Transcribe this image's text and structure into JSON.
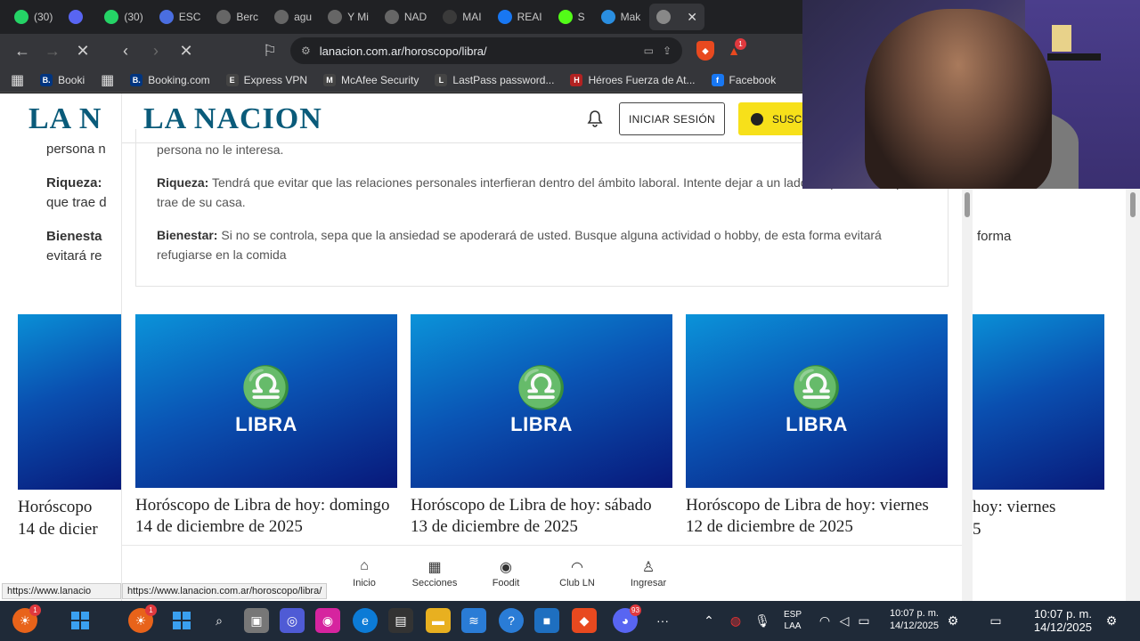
{
  "browser": {
    "tabs": [
      {
        "label": "(30)",
        "icon": "whatsapp-icon",
        "color": "#25d366"
      },
      {
        "label": "",
        "icon": "discord-icon",
        "color": "#5865f2"
      },
      {
        "label": "(30)",
        "icon": "whatsapp-icon",
        "color": "#25d366"
      },
      {
        "label": "ESC",
        "icon": "app-icon",
        "color": "#4a6ee0"
      },
      {
        "label": "Berc",
        "icon": "globe-icon",
        "color": "#666"
      },
      {
        "label": "agu",
        "icon": "globe-icon",
        "color": "#666"
      },
      {
        "label": "Y Mi",
        "icon": "globe-icon",
        "color": "#666"
      },
      {
        "label": "NAD",
        "icon": "globe-icon",
        "color": "#666"
      },
      {
        "label": "MAI",
        "icon": "app-icon",
        "color": "#3a3a3a"
      },
      {
        "label": "REAI",
        "icon": "facebook-icon",
        "color": "#1877f2"
      },
      {
        "label": "S",
        "icon": "kick-icon",
        "color": "#53fc18"
      },
      {
        "label": "Mak",
        "icon": "app-icon",
        "color": "#2a8ee0"
      },
      {
        "label": "",
        "icon": "loading-icon",
        "color": "#888"
      }
    ],
    "url": "lanacion.com.ar/horoscopo/libra/",
    "shield_badge": "1",
    "bookmarks": [
      {
        "label": "Booking.com",
        "color": "#003580",
        "glyph": "B."
      },
      {
        "label": "Express VPN",
        "color": "#444",
        "glyph": "E"
      },
      {
        "label": "McAfee Security",
        "color": "#444",
        "glyph": "M"
      },
      {
        "label": "LastPass password...",
        "color": "#444",
        "glyph": "L"
      },
      {
        "label": "Héroes Fuerza de At...",
        "color": "#b22222",
        "glyph": "H"
      },
      {
        "label": "Facebook",
        "color": "#1877f2",
        "glyph": "f"
      }
    ],
    "ghost_bookmark": "Booki"
  },
  "site": {
    "logo": "LA NACION",
    "ghost_logo": "LA N",
    "login_label": "INICIAR SESIÓN",
    "subscribe_label": "SUSCR"
  },
  "horoscope": {
    "love_tail": "persona no le interesa.",
    "wealth_label": "Riqueza:",
    "wealth_text": " Tendrá que evitar que las relaciones personales interfieran dentro del ámbito laboral. Intente dejar a un lado los problemas que trae de su casa.",
    "wellbeing_label": "Bienestar:",
    "wellbeing_text": " Si no se controla, sepa que la ansiedad se apoderará de usted. Busque alguna actividad o hobby, de esta forma evitará refugiarse en la comida"
  },
  "ghost_left": {
    "love_tail": "persona n",
    "wealth": "Riqueza:",
    "wealth_tail": "que trae d",
    "wellbeing": "Bienesta",
    "wellbeing_tail": "evitará re",
    "title_line1": "Horóscopo",
    "title_line2": "14 de dicier"
  },
  "ghost_right": {
    "wellbeing_tail": "forma",
    "title_line1": "hoy: viernes",
    "title_line2": "5"
  },
  "articles": [
    {
      "sign": "LIBRA",
      "glyph": "♎",
      "title": "Horóscopo de Libra de hoy: domingo 14 de diciembre de 2025"
    },
    {
      "sign": "LIBRA",
      "glyph": "♎",
      "title": "Horóscopo de Libra de hoy: sábado 13 de diciembre de 2025"
    },
    {
      "sign": "LIBRA",
      "glyph": "♎",
      "title": "Horóscopo de Libra de hoy: viernes 12 de diciembre de 2025"
    }
  ],
  "bottom_nav": [
    {
      "label": "Inicio",
      "icon": "home-icon",
      "glyph": "⌂"
    },
    {
      "label": "Secciones",
      "icon": "grid-icon",
      "glyph": "▦"
    },
    {
      "label": "Foodit",
      "icon": "food-icon",
      "glyph": "◉"
    },
    {
      "label": "Club LN",
      "icon": "club-icon",
      "glyph": "◠"
    },
    {
      "label": "Ingresar",
      "icon": "user-icon",
      "glyph": "♙"
    }
  ],
  "status_url_main": "https://www.lanacion.com.ar/horoscopo/libra/",
  "status_url_ghost": "https://www.lanacio",
  "taskbar": {
    "lang_main": "ESP",
    "lang_sub": "LAA",
    "time": "10:07 p. m.",
    "date": "14/12/2025",
    "ghost_time": "10:07 p. m.",
    "ghost_date": "14/12/2025",
    "badge_main": "1",
    "badge_ghost": "1",
    "discord_badge": "93"
  }
}
